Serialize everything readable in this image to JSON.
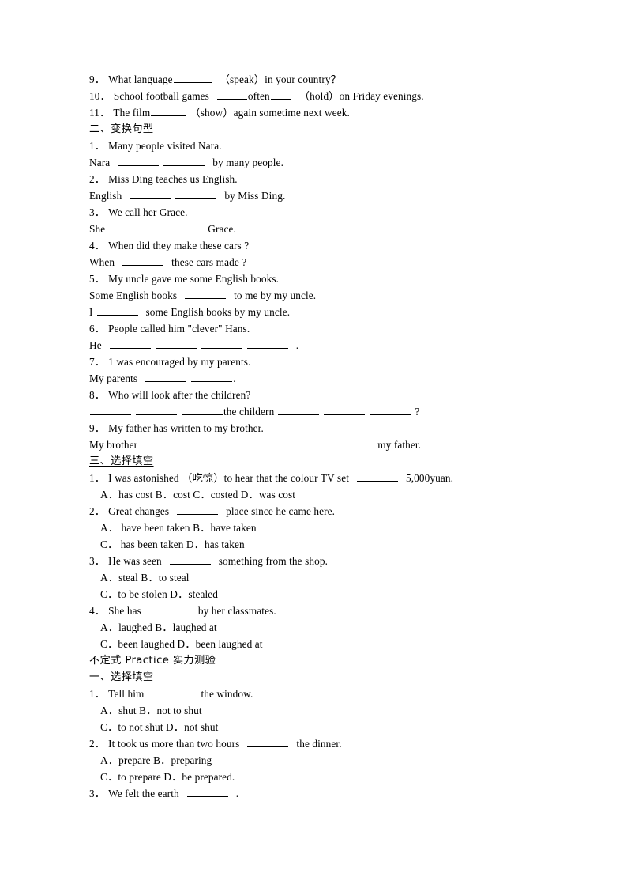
{
  "document": {
    "type": "english-grammar-worksheet",
    "page_background": "#ffffff",
    "text_color": "#000000"
  },
  "fill_in_section_tail": {
    "q9": {
      "num": "9．",
      "before": "What language",
      "after": "（speak）in your country？"
    },
    "q10": {
      "num": "10．",
      "before": "School football games",
      "middle": "often",
      "after": "（hold）on Friday evenings."
    },
    "q11": {
      "num": "11．",
      "before": "The film",
      "after": "（show）again sometime next week."
    }
  },
  "section_two": {
    "heading": "二、变换句型",
    "items": [
      {
        "num": "1．",
        "prompt": "Many people visited Nara.",
        "answer_before": "Nara",
        "answer_after": "by many people."
      },
      {
        "num": "2．",
        "prompt": "Miss Ding teaches us English.",
        "answer_before": "English",
        "answer_after": "by Miss Ding."
      },
      {
        "num": "3．",
        "prompt": "We call her Grace.",
        "answer_before": "She",
        "answer_after": "Grace."
      },
      {
        "num": "4．",
        "prompt": "When did they make these cars ?",
        "answer_before": "When",
        "answer_after": "these cars made ?"
      },
      {
        "num": "5．",
        "prompt": "My uncle gave me some English books.",
        "answer_before": "Some English books",
        "answer_after": "to me by my uncle.",
        "answer2_before": "I",
        "answer2_after": "some English books by my uncle."
      },
      {
        "num": "6．",
        "prompt": "People called him \"clever\" Hans.",
        "answer_before": "He",
        "answer_after": "."
      },
      {
        "num": "7．",
        "prompt": "1 was encouraged by my parents.",
        "answer_before": "My parents",
        "answer_after": "."
      },
      {
        "num": "8．",
        "prompt": "Who will look after the children?",
        "answer_middle": "the childern",
        "answer_after": "?"
      },
      {
        "num": "9．",
        "prompt": "My father has written to my brother.",
        "answer_before": "My brother",
        "answer_after": "my father."
      }
    ]
  },
  "section_three": {
    "heading": "三、选择填空",
    "items": [
      {
        "num": "1．",
        "stem_before": "I was astonished （吃惊）to hear that the colour TV set",
        "stem_after": "5,000yuan.",
        "option_lines": [
          {
            "indent": true,
            "text": "A．has cost B．cost C．costed D．was cost"
          }
        ]
      },
      {
        "num": "2．",
        "stem_before": "Great changes",
        "stem_after": "place since he came here.",
        "option_lines": [
          {
            "indent": true,
            "text": "A． have been taken B．have taken"
          },
          {
            "indent": true,
            "text": "C． has been taken  D．has taken"
          }
        ]
      },
      {
        "num": "3．",
        "stem_before": "He was seen",
        "stem_after": "something from the shop.",
        "option_lines": [
          {
            "indent": true,
            "text": "A．steal        B．to steal"
          },
          {
            "indent": true,
            "text": "C．to be stolen D．stealed"
          }
        ]
      },
      {
        "num": "4．",
        "stem_before": "She has",
        "stem_after": "by her classmates.",
        "option_lines": [
          {
            "indent": true,
            "text": "A．laughed      B．laughed at"
          },
          {
            "indent": true,
            "text": "C．been laughed D．been laughed at"
          }
        ]
      }
    ]
  },
  "practice_block": {
    "title": "不定式 Practice 实力测验",
    "heading": "一、选择填空",
    "items": [
      {
        "num": "1．",
        "stem_before": "Tell him",
        "stem_after": "the window.",
        "option_lines": [
          {
            "indent": true,
            "text": "A．shut         B．not to shut"
          },
          {
            "indent": true,
            "text": "C．to not shut D．not shut"
          }
        ]
      },
      {
        "num": "2．",
        "stem_before": "It took us more than two hours",
        "stem_after": "the dinner.",
        "option_lines": [
          {
            "indent": true,
            "text": "A．prepare    B．preparing"
          },
          {
            "indent": true,
            "text": "C．to prepare D．be prepared."
          }
        ]
      },
      {
        "num": "3．",
        "stem_before": "We felt the earth",
        "stem_after": "."
      }
    ]
  }
}
